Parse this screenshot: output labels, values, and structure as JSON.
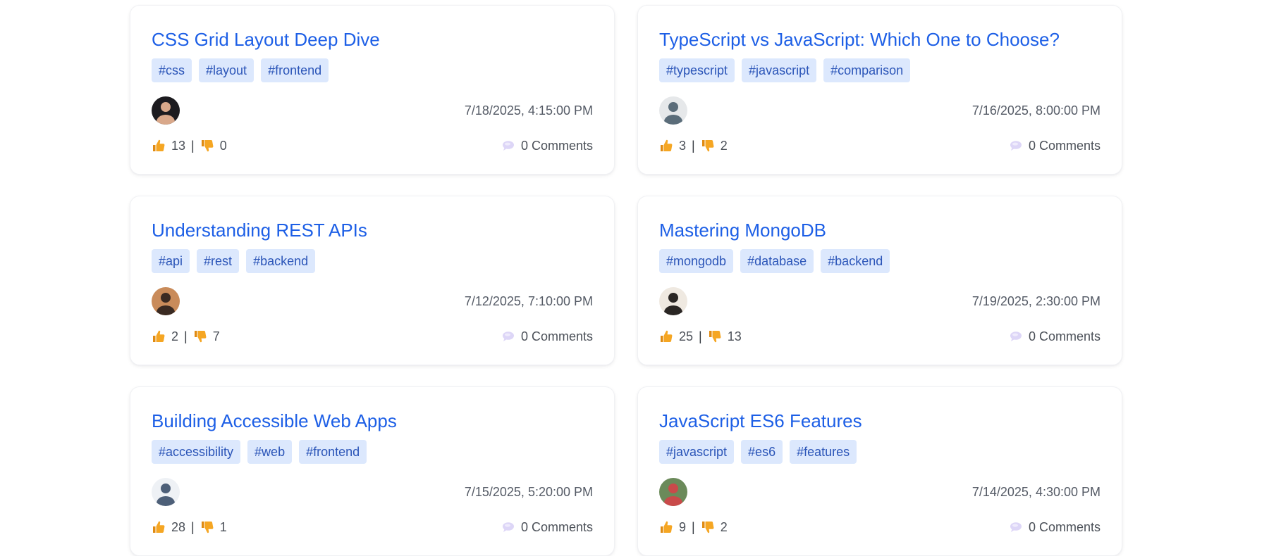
{
  "posts": [
    {
      "title": "CSS Grid Layout Deep Dive",
      "tags": [
        "#css",
        "#layout",
        "#frontend"
      ],
      "date": "7/18/2025, 4:15:00 PM",
      "likes": "13",
      "separator": "|",
      "dislikes": "0",
      "comments": "0 Comments",
      "avatar": {
        "bg": "#1c1b1f",
        "fg": "#d9a88a"
      }
    },
    {
      "title": "TypeScript vs JavaScript: Which One to Choose?",
      "tags": [
        "#typescript",
        "#javascript",
        "#comparison"
      ],
      "date": "7/16/2025, 8:00:00 PM",
      "likes": "3",
      "separator": "|",
      "dislikes": "2",
      "comments": "0 Comments",
      "avatar": {
        "bg": "#e6e8ea",
        "fg": "#5b6d7a"
      }
    },
    {
      "title": "Understanding REST APIs",
      "tags": [
        "#api",
        "#rest",
        "#backend"
      ],
      "date": "7/12/2025, 7:10:00 PM",
      "likes": "2",
      "separator": "|",
      "dislikes": "7",
      "comments": "0 Comments",
      "avatar": {
        "bg": "#c98b5a",
        "fg": "#3a2a22"
      }
    },
    {
      "title": "Mastering MongoDB",
      "tags": [
        "#mongodb",
        "#database",
        "#backend"
      ],
      "date": "7/19/2025, 2:30:00 PM",
      "likes": "25",
      "separator": "|",
      "dislikes": "13",
      "comments": "0 Comments",
      "avatar": {
        "bg": "#efe9e1",
        "fg": "#2a2624"
      }
    },
    {
      "title": "Building Accessible Web Apps",
      "tags": [
        "#accessibility",
        "#web",
        "#frontend"
      ],
      "date": "7/15/2025, 5:20:00 PM",
      "likes": "28",
      "separator": "|",
      "dislikes": "1",
      "comments": "0 Comments",
      "avatar": {
        "bg": "#eef1f5",
        "fg": "#4d5f78"
      }
    },
    {
      "title": "JavaScript ES6 Features",
      "tags": [
        "#javascript",
        "#es6",
        "#features"
      ],
      "date": "7/14/2025, 4:30:00 PM",
      "likes": "9",
      "separator": "|",
      "dislikes": "2",
      "comments": "0 Comments",
      "avatar": {
        "bg": "#6b8a5a",
        "fg": "#c94a4a"
      }
    }
  ],
  "icons": {
    "like": "thumbs-up-icon",
    "dislike": "thumbs-down-icon",
    "comment": "speech-bubble-icon"
  },
  "colors": {
    "title": "#1d5fe6",
    "tag_bg": "#dce8fd",
    "tag_text": "#2b55b8",
    "thumb": "#f5a623",
    "comment_icon": "#c8bff0"
  }
}
